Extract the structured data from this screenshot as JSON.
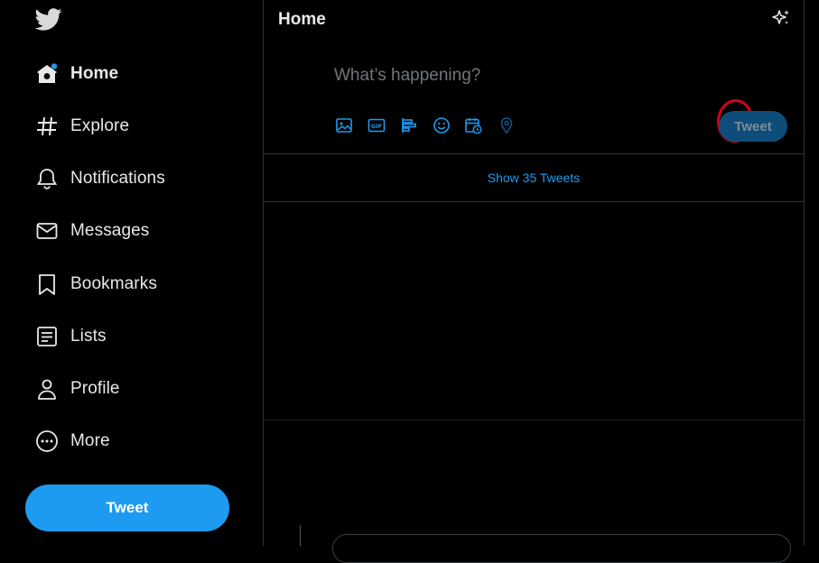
{
  "sidebar": {
    "logo_icon": "twitter-bird-icon",
    "items": [
      {
        "label": "Home",
        "icon": "home-icon",
        "active": true
      },
      {
        "label": "Explore",
        "icon": "hashtag-icon"
      },
      {
        "label": "Notifications",
        "icon": "bell-icon"
      },
      {
        "label": "Messages",
        "icon": "envelope-icon"
      },
      {
        "label": "Bookmarks",
        "icon": "bookmark-icon"
      },
      {
        "label": "Lists",
        "icon": "list-icon"
      },
      {
        "label": "Profile",
        "icon": "person-icon"
      },
      {
        "label": "More",
        "icon": "more-circle-icon"
      }
    ],
    "tweet_button": "Tweet"
  },
  "header": {
    "title": "Home",
    "sparkle_icon": "sparkle-icon"
  },
  "composer": {
    "placeholder": "What’s happening?",
    "tweet_button": "Tweet",
    "toolbar_icons": [
      "image-icon",
      "gif-icon",
      "poll-icon",
      "emoji-icon",
      "schedule-icon",
      "location-icon"
    ]
  },
  "timeline": {
    "show_tweets": "Show 35 Tweets"
  },
  "colors": {
    "accent": "#1d9bf0",
    "background": "#000000",
    "annotation": "#d0021b"
  }
}
